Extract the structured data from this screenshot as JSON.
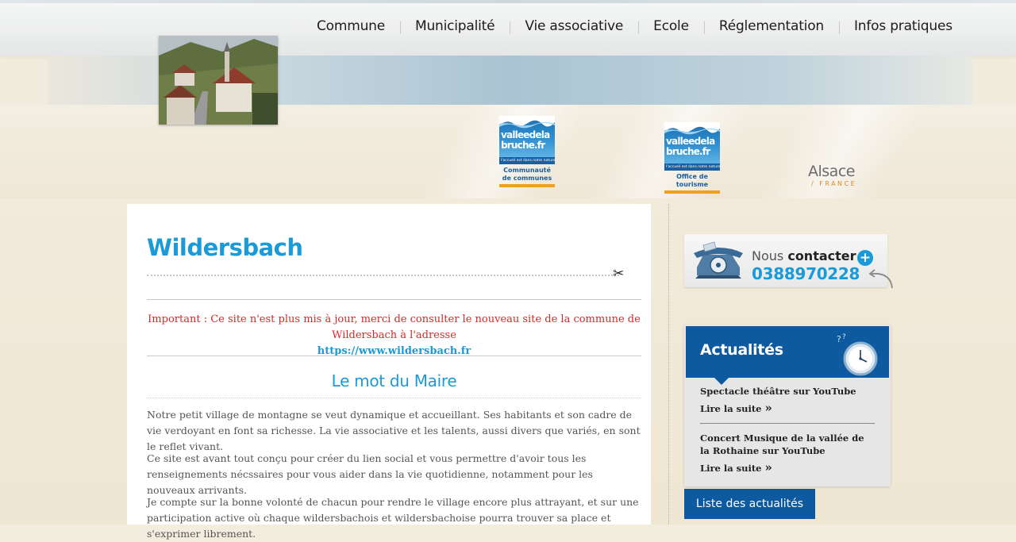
{
  "nav": {
    "items": [
      "Commune",
      "Municipalité",
      "Vie associative",
      "Ecole",
      "Réglementation",
      "Infos pratiques"
    ]
  },
  "logos": {
    "ccvb": {
      "line1": "valleedela",
      "line2": "bruche.fr",
      "tagline": "l'accueil est dans notre nature",
      "sub": "Communauté de communes"
    },
    "otvb": {
      "line1": "valleedela",
      "line2": "bruche.fr",
      "tagline": "l'accueil est dans notre nature",
      "sub": "Office de tourisme"
    },
    "alsace": {
      "word": "Alsace",
      "country": "/ FRANCE"
    }
  },
  "main": {
    "title": "Wildersbach",
    "notice_text": "Important : Ce site n'est plus mis à jour, merci de consulter le nouveau site de la commune de Wildersbach  à l'adresse",
    "notice_link": "https://www.wildersbach.fr",
    "section_title": "Le mot du Maire",
    "paragraphs": [
      "Notre petit village de montagne se veut dynamique et accueillant. Ses habitants et son cadre de vie verdoyant en font sa richesse. La vie associative et les talents, aussi divers que variés, en sont le reflet vivant.",
      "Ce site est avant tout conçu pour créer du lien social et vous permettre d'avoir tous les renseignements nécssaires pour vous aider dans la vie quotidienne, notamment pour les nouveaux arrivants.",
      "Je compte sur la bonne volonté de chacun pour rendre le village encore plus attrayant, et sur une participation active où chaque wildersbachois et wildersbachoise pourra trouver sa place et s'exprimer librement."
    ]
  },
  "contact": {
    "label_light": "Nous",
    "label_bold": "contacter",
    "plus": "+",
    "phone": "0388970228"
  },
  "news": {
    "title": "Actualités",
    "items": [
      {
        "title": "Spectacle théâtre sur YouTube",
        "more": "Lire la suite"
      },
      {
        "title": "Concert Musique de la vallée de la Rothaine sur YouTube",
        "more": "Lire la suite"
      }
    ],
    "list_button": "Liste des actualités"
  },
  "colors": {
    "accent": "#1a9ad6",
    "news_blue": "#0d5aa0",
    "notice_red": "#d9262a"
  }
}
